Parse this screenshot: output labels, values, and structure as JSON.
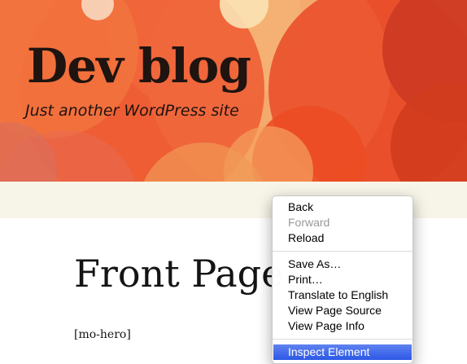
{
  "site": {
    "title": "Dev blog",
    "tagline": "Just another WordPress site"
  },
  "page": {
    "title": "Front Page",
    "content": "[mo-hero]"
  },
  "context_menu": {
    "items": [
      {
        "label": "Back",
        "enabled": true
      },
      {
        "label": "Forward",
        "enabled": false
      },
      {
        "label": "Reload",
        "enabled": true
      },
      {
        "label": "Save As…",
        "enabled": true
      },
      {
        "label": "Print…",
        "enabled": true
      },
      {
        "label": "Translate to English",
        "enabled": true
      },
      {
        "label": "View Page Source",
        "enabled": true
      },
      {
        "label": "View Page Info",
        "enabled": true
      },
      {
        "label": "Inspect Element",
        "enabled": true,
        "highlighted": true
      }
    ]
  },
  "colors": {
    "header_base": "#f26a3c",
    "nav_bar": "#f7f5e8",
    "menu_highlight": "#3a65ea"
  }
}
